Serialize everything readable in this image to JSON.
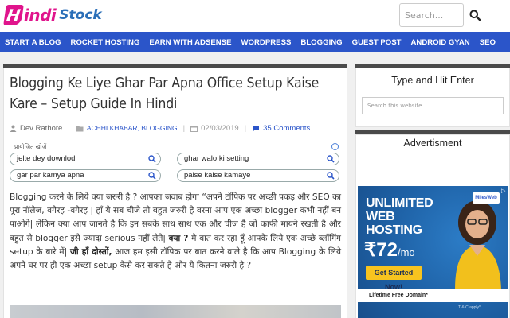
{
  "logo": {
    "hindi_part": "indi",
    "stock_part": "Stock",
    "badge_letter": "H",
    "brand_pink": "#e0148c",
    "brand_blue": "#2b6fb8"
  },
  "header": {
    "search_placeholder": "Search...",
    "search_icon": "search-icon"
  },
  "nav": {
    "bg_color": "#2b55c9",
    "items": [
      "START A BLOG",
      "ROCKET HOSTING",
      "EARN WITH ADSENSE",
      "WORDPRESS",
      "BLOGGING",
      "GUEST POST",
      "ANDROID GYAN",
      "SEO"
    ]
  },
  "article": {
    "title": "Blogging Ke Liye Ghar Par Apna Office Setup Kaise Kare – Setup Guide In Hindi",
    "meta": {
      "author": "Dev Rathore",
      "categories": "ACHHI KHABAR, BLOGGING",
      "date": "02/03/2019",
      "comments": "35 Comments"
    },
    "related": {
      "label": "प्रायोजित खोजें",
      "items": [
        "jelte dey downlod",
        "ghar walo ki setting",
        "gar par kamya apna",
        "paise kaise kamaye"
      ]
    },
    "body": {
      "p1": "Blogging करने के लिये क्या जरुरी है ? आपका जवाब होगा “अपने टॉपिक पर अच्छी पकड़ और SEO का पूरा नॉलेज, वगैरह -वगैरह | हाँ ये सब चीजे तो बहुत जरुरी है वरना आप एक अच्छा blogger कभी नहीं बन पाओगे| लेकिन क्या आप जानते है कि इन सबके साथ साथ एक और चीज है जो काफी मायने रखती है और बहुत से blogger इसे ज्यादा serious नहीं लेते|",
      "q": "क्या ?",
      "p2": "मै बात कर रहा हूँ आपके लिये एक अच्छे ब्लॉगिंग setup के बारे में|",
      "friends": "जी हाँ दोस्तों,",
      "p3": "आज हम इसी टॉपिक पर बात करने वाले है कि आप Blogging के लिये अपने घर पर ही एक अच्छा setup कैसे कर सकते है और ये कितना जरुरी है ?"
    }
  },
  "sidebar": {
    "search_widget": {
      "title": "Type and Hit Enter",
      "placeholder": "Search this website"
    },
    "ad_widget": {
      "title": "Advertisment",
      "logo": "MilesWeb",
      "line1": "UNLIMITED",
      "line2": "WEB",
      "line3": "HOSTING",
      "price": "₹72",
      "price_unit": "/mo",
      "cta": "Get Started Now!",
      "strip": "Lifetime Free Domain*",
      "tc": "T & C apply*"
    }
  }
}
